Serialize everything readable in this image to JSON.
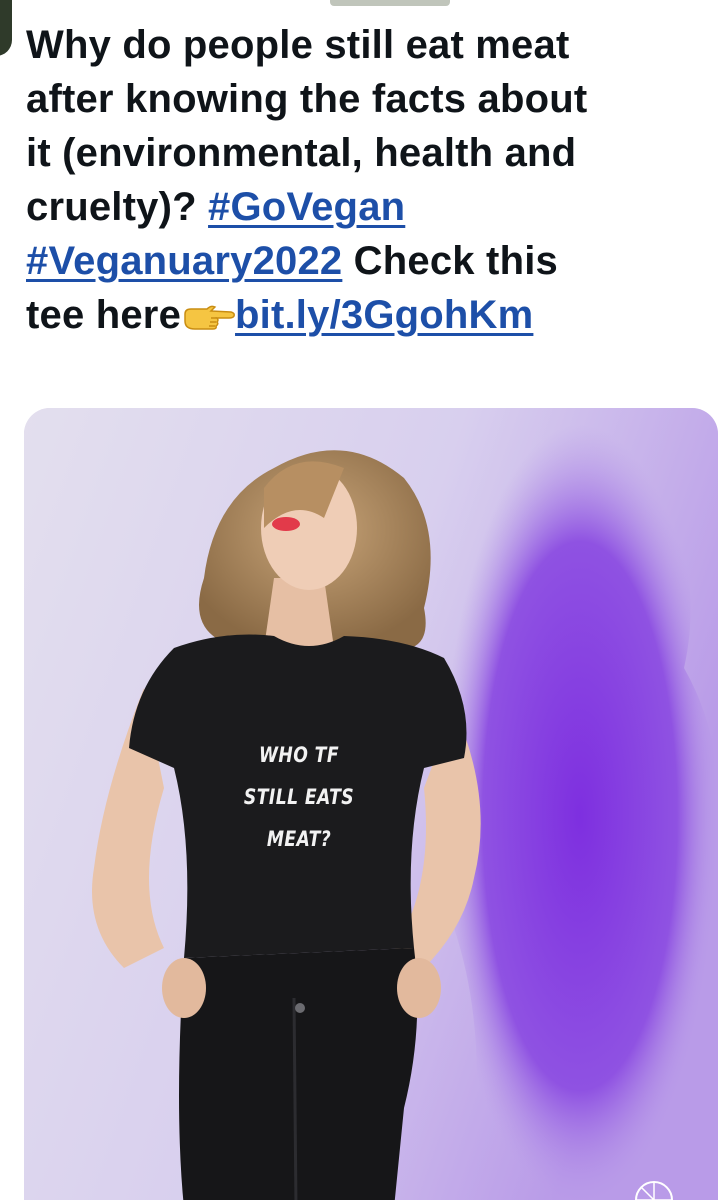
{
  "tweet": {
    "text_lines": {
      "line1": "Why do people still eat meat",
      "line2": "after knowing the facts about",
      "line3": "it (environmental, health and",
      "line4_prefix": "cruelty)? ",
      "line6_suffix": " Check this",
      "line7_prefix": "tee here"
    },
    "hashtags": [
      "#GoVegan",
      "#Veganuary2022"
    ],
    "link": "bit.ly/3GgohKm",
    "emoji": "backhand-index-pointing-right",
    "link_color": "#1d4fa8",
    "text_color": "#0f1419"
  },
  "media": {
    "shirt_text": [
      "WHO TF",
      "STILL EATS",
      "MEAT?"
    ],
    "background_color": "#dcd6ea",
    "accent_color": "#8a3fe0"
  }
}
